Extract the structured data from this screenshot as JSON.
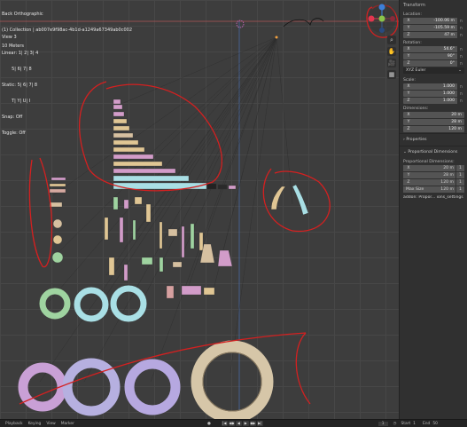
{
  "viewport": {
    "overlay_lines": [
      {
        "text": "Back Orthographic"
      },
      {
        "text": "(1) Collection | ab007e9f98ac-4b1d-a1249a67349ab0c002"
      },
      {
        "text": "10 Meters"
      }
    ],
    "stats_lines": [
      {
        "text": "View 3"
      },
      {
        "text": "Linear: 1| 2| 3| 4"
      },
      {
        "text": "       5| 6| 7| 8"
      },
      {
        "text": "Static: 5| 6| 7| 8"
      },
      {
        "text": "       T| Y| U| I"
      },
      {
        "text": "Snap: Off"
      },
      {
        "text": "Toggle: Off"
      }
    ]
  },
  "gizmo": {
    "axis_x_color": "#e2364f",
    "axis_y_color": "#8ac54a",
    "axis_z_color": "#3d7fd9"
  },
  "nav_tools": [
    {
      "icon": "zoom-icon",
      "glyph": "⌕"
    },
    {
      "icon": "hand-icon",
      "glyph": "✋"
    },
    {
      "icon": "camera-icon",
      "glyph": "🎥"
    },
    {
      "icon": "grid-icon",
      "glyph": "▦"
    }
  ],
  "npanel": {
    "header": "Transform",
    "location_label": "Location:",
    "location": [
      {
        "axis": "X",
        "value": "-100.06 m"
      },
      {
        "axis": "Y",
        "value": "-105.59 m"
      },
      {
        "axis": "Z",
        "value": "47 m"
      }
    ],
    "rotation_label": "Rotation:",
    "rotation": [
      {
        "axis": "X",
        "value": "54.6°"
      },
      {
        "axis": "Y",
        "value": "90°"
      },
      {
        "axis": "Z",
        "value": "0°"
      }
    ],
    "rotation_mode": "XYZ Euler",
    "scale_label": "Scale:",
    "scale": [
      {
        "axis": "X",
        "value": "1.000"
      },
      {
        "axis": "Y",
        "value": "1.000"
      },
      {
        "axis": "Z",
        "value": "1.000"
      }
    ],
    "dimensions_label": "Dimensions:",
    "dimensions": [
      {
        "axis": "X",
        "value": "20 m"
      },
      {
        "axis": "Y",
        "value": "28 m"
      },
      {
        "axis": "Z",
        "value": "120 m"
      }
    ],
    "properties_label": "Properties",
    "prop_dim_header": "Proportional Dimensions",
    "prop_dim_label": "Proportional Dimensions:",
    "prop_dims": [
      {
        "axis": "X",
        "value": "20 m",
        "num": "1"
      },
      {
        "axis": "Y",
        "value": "28 m",
        "num": "1"
      },
      {
        "axis": "Z",
        "value": "120 m",
        "num": "1"
      }
    ],
    "max_size_label": "Max Size",
    "max_size_value": "120 m",
    "max_size_num": "1",
    "addon_note": "addon: Propor... ions_settings"
  },
  "timeline": {
    "playback": "Playback",
    "keying": "Keying",
    "view": "View",
    "marker": "Marker",
    "current_frame": "1",
    "start_label": "Start",
    "start_value": "1",
    "end_label": "End",
    "end_value": "50"
  }
}
